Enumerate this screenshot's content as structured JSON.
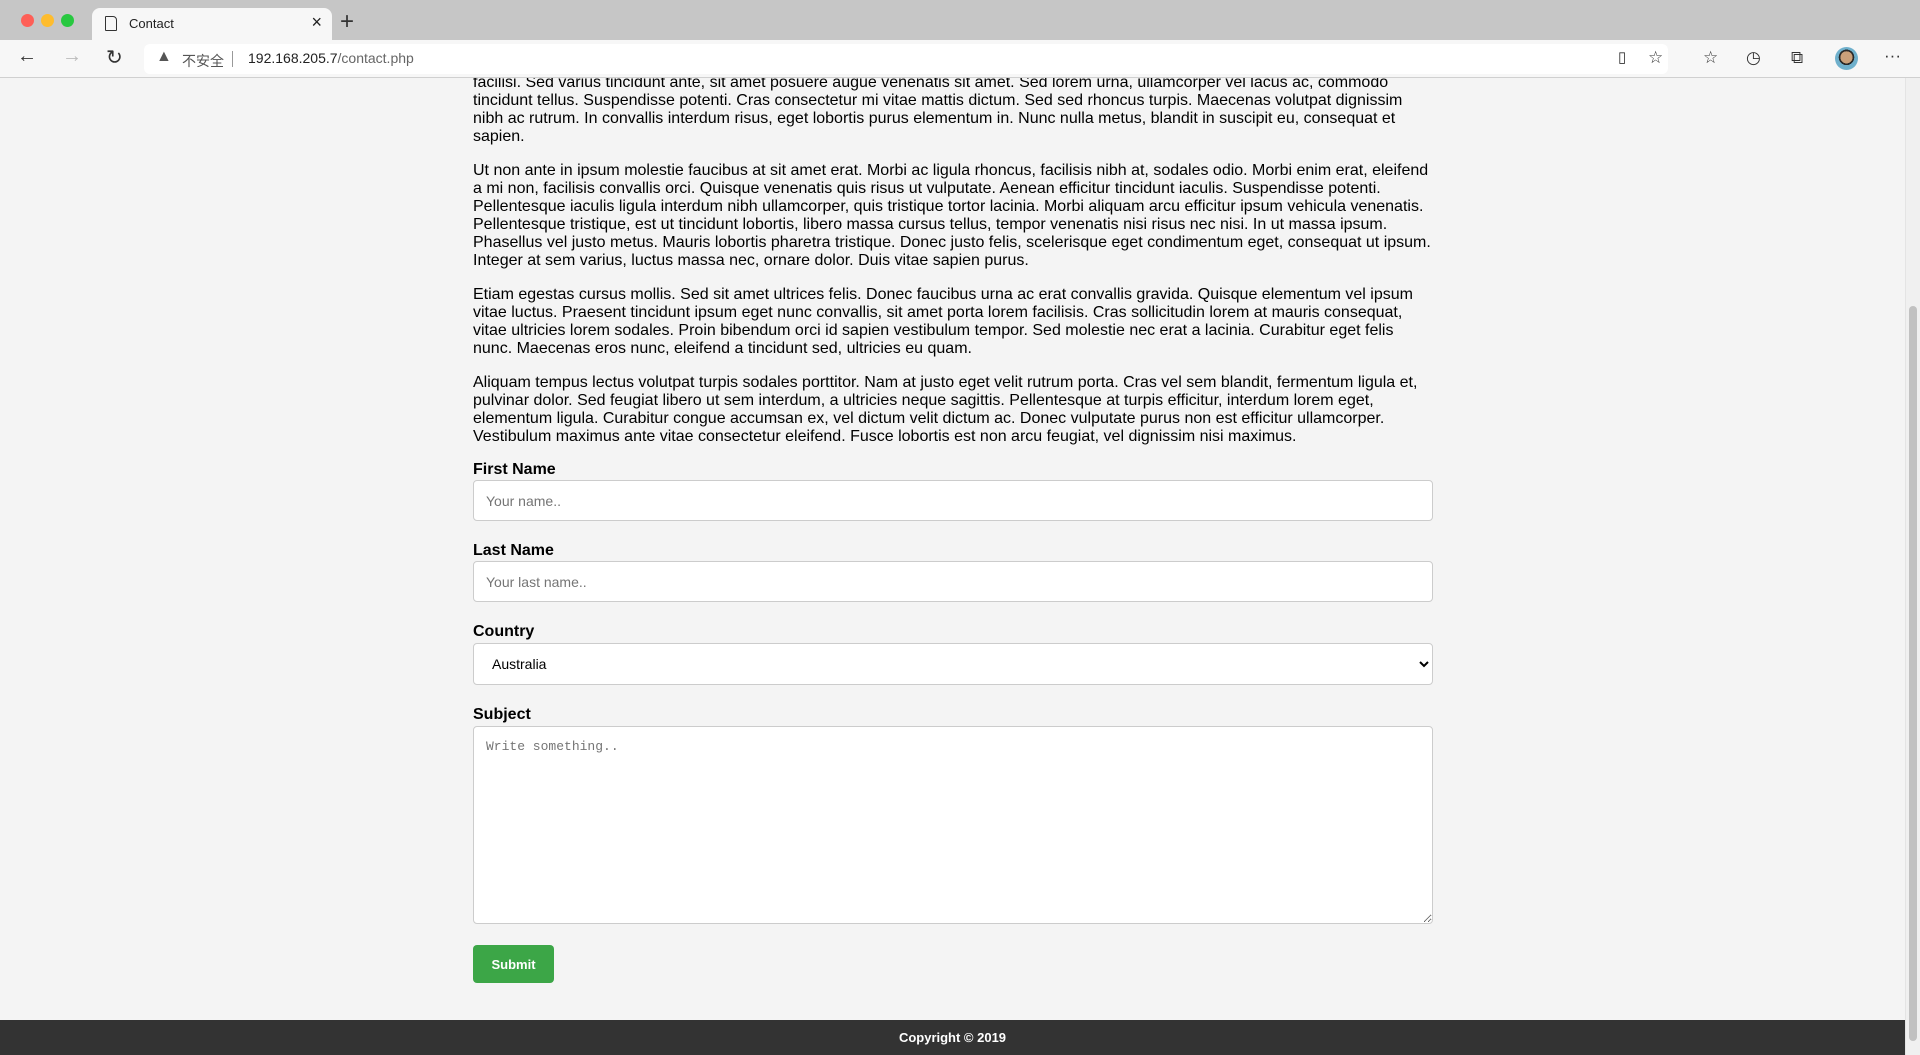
{
  "browser": {
    "tab_title": "Contact",
    "security_label": "不安全",
    "url_host": "192.168.205.7",
    "url_path": "/contact.php",
    "icons": [
      "back-icon",
      "forward-icon",
      "reload-icon",
      "warning-icon",
      "read-aloud-icon",
      "add-favorite-icon",
      "favorites-icon",
      "history-icon",
      "collections-icon",
      "profile-avatar",
      "more-icon"
    ]
  },
  "content": {
    "paragraphs": [
      "facilisi. Sed varius tincidunt ante, sit amet posuere augue venenatis sit amet. Sed lorem urna, ullamcorper vel lacus ac, commodo tincidunt tellus. Suspendisse potenti. Cras consectetur mi vitae mattis dictum. Sed sed rhoncus turpis. Maecenas volutpat dignissim nibh ac rutrum. In convallis interdum risus, eget lobortis purus elementum in. Nunc nulla metus, blandit in suscipit eu, consequat et sapien.",
      "Ut non ante in ipsum molestie faucibus at sit amet erat. Morbi ac ligula rhoncus, facilisis nibh at, sodales odio. Morbi enim erat, eleifend a mi non, facilisis convallis orci. Quisque venenatis quis risus ut vulputate. Aenean efficitur tincidunt iaculis. Suspendisse potenti. Pellentesque iaculis ligula interdum nibh ullamcorper, quis tristique tortor lacinia. Morbi aliquam arcu efficitur ipsum vehicula venenatis. Pellentesque tristique, est ut tincidunt lobortis, libero massa cursus tellus, tempor venenatis nisi risus nec nisi. In ut massa ipsum. Phasellus vel justo metus. Mauris lobortis pharetra tristique. Donec justo felis, scelerisque eget condimentum eget, consequat ut ipsum. Integer at sem varius, luctus massa nec, ornare dolor. Duis vitae sapien purus.",
      "Etiam egestas cursus mollis. Sed sit amet ultrices felis. Donec faucibus urna ac erat convallis gravida. Quisque elementum vel ipsum vitae luctus. Praesent tincidunt ipsum eget nunc convallis, sit amet porta lorem facilisis. Cras sollicitudin lorem at mauris consequat, vitae ultricies lorem sodales. Proin bibendum orci id sapien vestibulum tempor. Sed molestie nec erat a lacinia. Curabitur eget felis nunc. Maecenas eros nunc, eleifend a tincidunt sed, ultricies eu quam.",
      "Aliquam tempus lectus volutpat turpis sodales porttitor. Nam at justo eget velit rutrum porta. Cras vel sem blandit, fermentum ligula et, pulvinar dolor. Sed feugiat libero ut sem interdum, a ultricies neque sagittis. Pellentesque at turpis efficitur, interdum lorem eget, elementum ligula. Curabitur congue accumsan ex, vel dictum velit dictum ac. Donec vulputate purus non est efficitur ullamcorper. Vestibulum maximus ante vitae consectetur eleifend. Fusce lobortis est non arcu feugiat, vel dignissim nisi maximus."
    ]
  },
  "form": {
    "first_name_label": "First Name",
    "first_name_placeholder": "Your name..",
    "first_name_value": "",
    "last_name_label": "Last Name",
    "last_name_placeholder": "Your last name..",
    "last_name_value": "",
    "country_label": "Country",
    "country_selected": "Australia",
    "subject_label": "Subject",
    "subject_placeholder": "Write something..",
    "subject_value": "",
    "submit_label": "Submit",
    "submit_color": "#3ca647"
  },
  "footer": {
    "copyright": "Copyright © 2019"
  }
}
